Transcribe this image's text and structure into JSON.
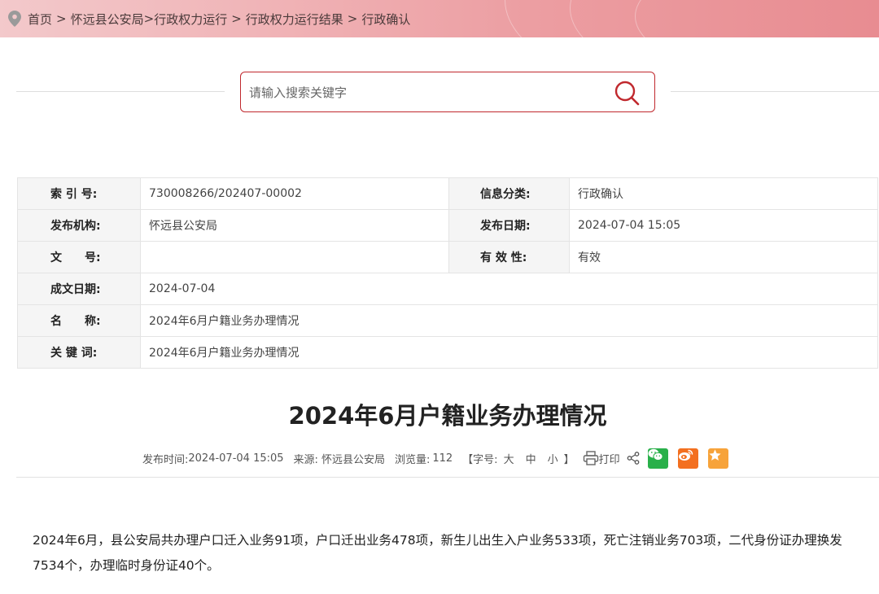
{
  "breadcrumb": {
    "items": [
      "首页",
      "怀远县公安局",
      "行政权力运行",
      "行政权力运行结果",
      "行政确认"
    ],
    "separators": [
      ">",
      ">",
      ">",
      ">"
    ]
  },
  "search": {
    "placeholder": "请输入搜索关键字"
  },
  "meta": {
    "index_label": "索 引 号:",
    "index_value": "730008266/202407-00002",
    "category_label": "信息分类:",
    "category_value": "行政确认",
    "publisher_label": "发布机构:",
    "publisher_value": "怀远县公安局",
    "pubdate_label": "发布日期:",
    "pubdate_value": "2024-07-04 15:05",
    "docno_label": "文　　号:",
    "docno_value": "",
    "validity_label": "有 效 性:",
    "validity_value": "有效",
    "created_label": "成文日期:",
    "created_value": "2024-07-04",
    "name_label": "名　　称:",
    "name_value": "2024年6月户籍业务办理情况",
    "keywords_label": "关 键 词:",
    "keywords_value": "2024年6月户籍业务办理情况"
  },
  "article": {
    "title": "2024年6月户籍业务办理情况",
    "pubtime_label": "发布时间:",
    "pubtime_value": "2024-07-04 15:05",
    "source_label": "来源:",
    "source_value": "怀远县公安局",
    "views_label": "浏览量:",
    "views_value": "112",
    "fontsize_label": "【字号:",
    "fontsize_large": "大",
    "fontsize_medium": "中",
    "fontsize_small": "小",
    "fontsize_end": "】",
    "print_label": "打印",
    "body": "2024年6月，县公安局共办理户口迁入业务91项，户口迁出业务478项，新生儿出生入户业务533项，死亡注销业务703项，二代身份证办理换发7534个，办理临时身份证40个。"
  },
  "colors": {
    "accent": "#c0282d",
    "wechat": "#29b04a",
    "weibo": "#f36f1f",
    "favorite": "#f7a33a"
  }
}
